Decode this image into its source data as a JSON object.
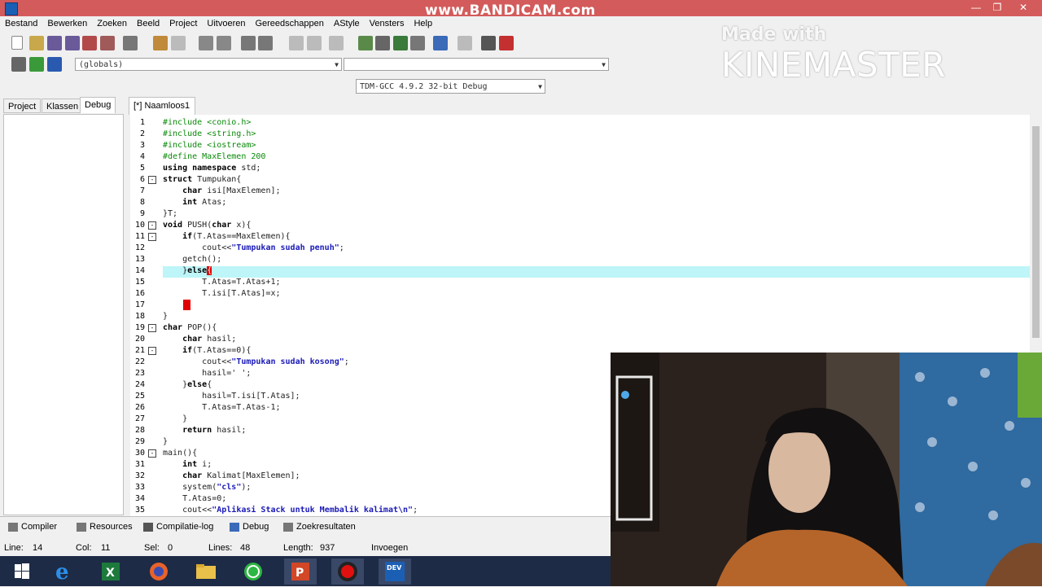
{
  "watermarks": {
    "bandicam": "www.BANDICAM.com",
    "kinemaster_made": "Made with",
    "kinemaster_name": "KINEMASTER"
  },
  "menu": [
    "Bestand",
    "Bewerken",
    "Zoeken",
    "Beeld",
    "Project",
    "Uitvoeren",
    "Gereedschappen",
    "AStyle",
    "Vensters",
    "Help"
  ],
  "globals_combo": "(globals)",
  "compiler_combo": "TDM-GCC 4.9.2 32-bit Debug",
  "side_tabs": [
    "Project",
    "Klassen",
    "Debug"
  ],
  "editor_tab": "[*] Naamloos1",
  "bottom_tabs": [
    "Compiler",
    "Resources",
    "Compilatie-log",
    "Debug",
    "Zoekresultaten"
  ],
  "status": {
    "line_label": "Line:",
    "line": "14",
    "col_label": "Col:",
    "col": "11",
    "sel_label": "Sel:",
    "sel": "0",
    "lines_label": "Lines:",
    "lines": "48",
    "length_label": "Length:",
    "length": "937",
    "mode": "Invoegen"
  },
  "line_numbers": [
    "1",
    "2",
    "3",
    "4",
    "5",
    "6",
    "7",
    "8",
    "9",
    "10",
    "11",
    "12",
    "13",
    "14",
    "15",
    "16",
    "17",
    "18",
    "19",
    "20",
    "21",
    "22",
    "23",
    "24",
    "25",
    "26",
    "27",
    "28",
    "29",
    "30",
    "31",
    "32",
    "33",
    "34",
    "35"
  ],
  "code": {
    "l1": "#include <conio.h>",
    "l2": "#include <string.h>",
    "l3": "#include <iostream>",
    "l4": "#define MaxElemen 200",
    "l5a": "using namespace",
    "l5b": " std;",
    "l6a": "struct",
    "l6b": " Tumpukan{",
    "l7a": "    char",
    "l7b": " isi[MaxElemen];",
    "l8a": "    int",
    "l8b": " Atas;",
    "l9": "}T;",
    "l10a": "void",
    "l10b": " PUSH(",
    "l10c": "char",
    "l10d": " x){",
    "l11a": "    if",
    "l11b": "(T.Atas==MaxElemen){",
    "l12a": "        cout<<",
    "l12b": "\"Tumpukan sudah penuh\"",
    "l12c": ";",
    "l13": "    getch();",
    "l14a": "    }",
    "l14b": "else",
    "l14c": "{",
    "l15": "        T.Atas=T.Atas+1;",
    "l16": "        T.isi[T.Atas]=x;",
    "l17": "    }",
    "l18": "}",
    "l19a": "char",
    "l19b": " POP(){",
    "l20a": "    char",
    "l20b": " hasil;",
    "l21a": "    if",
    "l21b": "(T.Atas==0){",
    "l22a": "        cout<<",
    "l22b": "\"Tumpukan sudah kosong\"",
    "l22c": ";",
    "l23": "        hasil=' ';",
    "l24a": "    }",
    "l24b": "else",
    "l24c": "{",
    "l25": "        hasil=T.isi[T.Atas];",
    "l26": "        T.Atas=T.Atas-1;",
    "l27": "    }",
    "l28a": "    return",
    "l28b": " hasil;",
    "l29": "}",
    "l30": "main(){",
    "l31a": "    int",
    "l31b": " i;",
    "l32a": "    char",
    "l32b": " Kalimat[MaxElemen];",
    "l33a": "    system(",
    "l33b": "\"cls\"",
    "l33c": ");",
    "l34": "    T.Atas=0;",
    "l35a": "    cout<<",
    "l35b": "\"Aplikasi Stack untuk Membalik kalimat\\n\"",
    "l35c": ";"
  },
  "colors": {
    "titlebar": "#d35b5b",
    "highlight": "#bef5f8",
    "taskbar": "#1d2b46"
  }
}
